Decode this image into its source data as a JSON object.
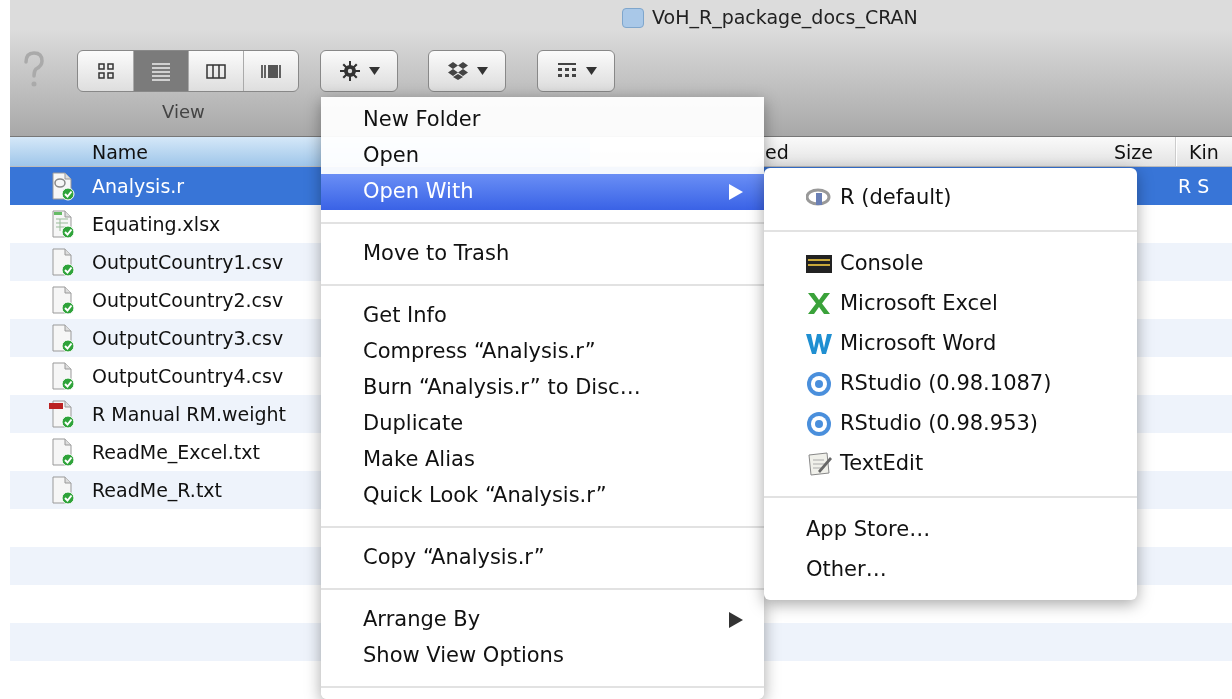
{
  "window": {
    "title": "VoH_R_package_docs_CRAN"
  },
  "toolbar": {
    "view_buttons": [
      {
        "kind": "icons",
        "selected": false
      },
      {
        "kind": "list",
        "selected": true
      },
      {
        "kind": "columns",
        "selected": false
      },
      {
        "kind": "coverflow",
        "selected": false
      }
    ],
    "view_label": "View",
    "menu_buttons": [
      {
        "kind": "gear"
      },
      {
        "kind": "dropbox"
      },
      {
        "kind": "arrange"
      }
    ]
  },
  "file_list": {
    "columns": [
      {
        "label": "Name",
        "sorted": true
      },
      {
        "label": "ed",
        "sorted": false
      },
      {
        "label": "Size",
        "sorted": false
      },
      {
        "label": "Kin",
        "sorted": false
      }
    ],
    "rows": [
      {
        "name": "Analysis.r",
        "kind": "r-script",
        "selected": true,
        "kind_column": "R S"
      },
      {
        "name": "Equating.xlsx",
        "kind": "spreadsheet",
        "selected": false
      },
      {
        "name": "OutputCountry1.csv",
        "kind": "document",
        "selected": false
      },
      {
        "name": "OutputCountry2.csv",
        "kind": "document",
        "selected": false
      },
      {
        "name": "OutputCountry3.csv",
        "kind": "document",
        "selected": false
      },
      {
        "name": "OutputCountry4.csv",
        "kind": "document",
        "selected": false
      },
      {
        "name": "R Manual RM.weight",
        "kind": "pdf",
        "selected": false
      },
      {
        "name": "ReadMe_Excel.txt",
        "kind": "document",
        "selected": false
      },
      {
        "name": "ReadMe_R.txt",
        "kind": "document",
        "selected": false
      }
    ]
  },
  "context_menu": {
    "groups": [
      [
        {
          "label": "New Folder",
          "submenu": false,
          "selected": false
        },
        {
          "label": "Open",
          "submenu": false,
          "selected": false
        },
        {
          "label": "Open With",
          "submenu": true,
          "selected": true
        }
      ],
      [
        {
          "label": "Move to Trash",
          "submenu": false,
          "selected": false
        }
      ],
      [
        {
          "label": "Get Info",
          "submenu": false,
          "selected": false
        },
        {
          "label": "Compress “Analysis.r”",
          "submenu": false,
          "selected": false
        },
        {
          "label": "Burn “Analysis.r” to Disc…",
          "submenu": false,
          "selected": false
        },
        {
          "label": "Duplicate",
          "submenu": false,
          "selected": false
        },
        {
          "label": "Make Alias",
          "submenu": false,
          "selected": false
        },
        {
          "label": "Quick Look “Analysis.r”",
          "submenu": false,
          "selected": false
        }
      ],
      [
        {
          "label": "Copy “Analysis.r”",
          "submenu": false,
          "selected": false
        }
      ],
      [
        {
          "label": "Arrange By",
          "submenu": true,
          "selected": false
        },
        {
          "label": "Show View Options",
          "submenu": false,
          "selected": false
        }
      ]
    ]
  },
  "open_with_submenu": {
    "groups": [
      [
        {
          "label": "R (default)",
          "kind": "r"
        }
      ],
      [
        {
          "label": "Console",
          "kind": "console"
        },
        {
          "label": "Microsoft Excel",
          "kind": "excel"
        },
        {
          "label": "Microsoft Word",
          "kind": "word"
        },
        {
          "label": "RStudio (0.98.1087)",
          "kind": "rstudio"
        },
        {
          "label": "RStudio (0.98.953)",
          "kind": "rstudio"
        },
        {
          "label": "TextEdit",
          "kind": "textedit"
        }
      ],
      [
        {
          "label": "App Store…",
          "kind": "none"
        },
        {
          "label": "Other…",
          "kind": "none"
        }
      ]
    ]
  }
}
